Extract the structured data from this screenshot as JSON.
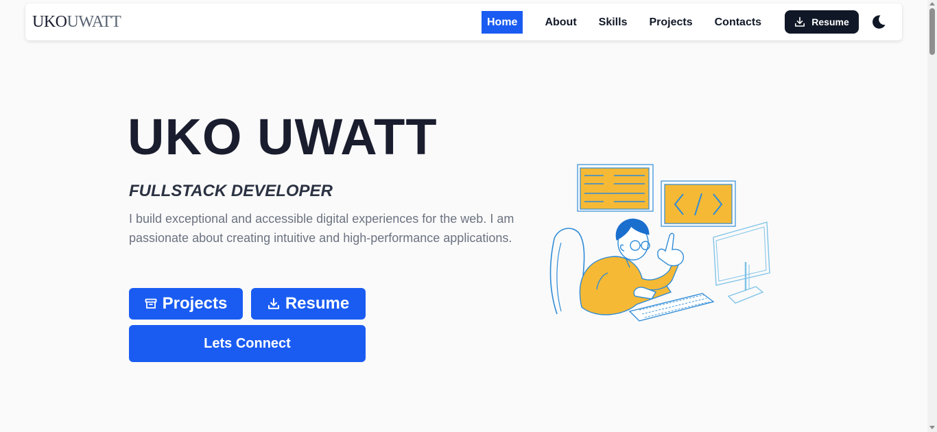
{
  "nav": {
    "logo_a": "UKO",
    "logo_b": "UWATT",
    "links": [
      "Home",
      "About",
      "Skills",
      "Projects",
      "Contacts"
    ],
    "active": "Home",
    "resume_label": "Resume",
    "theme_icon": "moon-icon"
  },
  "hero": {
    "name": "UKO UWATT",
    "role": "FULLSTACK DEVELOPER",
    "description": "I build exceptional and accessible digital experiences for the web. I am passionate about creating intuitive and high-performance applications.",
    "buttons": {
      "projects": "Projects",
      "resume": "Resume",
      "connect": "Lets Connect"
    },
    "illustration": "developer-at-computer-illustration"
  },
  "colors": {
    "accent": "#1a5cf2",
    "dark": "#101827",
    "illustration_yellow": "#f5b935",
    "illustration_blue": "#2e8bd7"
  }
}
